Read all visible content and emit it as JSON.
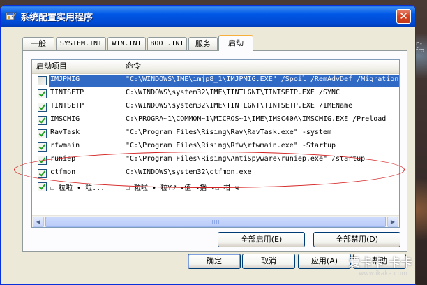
{
  "window": {
    "title": "系统配置实用程序",
    "close_glyph": "✕"
  },
  "tabs": [
    {
      "label": "一般"
    },
    {
      "label": "SYSTEM.INI"
    },
    {
      "label": "WIN.INI"
    },
    {
      "label": "BOOT.INI"
    },
    {
      "label": "服务"
    },
    {
      "label": "启动",
      "active": true
    }
  ],
  "listview": {
    "columns": [
      "启动项目",
      "命令"
    ],
    "rows": [
      {
        "name": "IMJPMIG",
        "command": "\"C:\\WINDOWS\\IME\\imjp8_1\\IMJPMIG.EXE\" /Spoil /RemAdvDef /Migration",
        "checked": false,
        "selected": true
      },
      {
        "name": "TINTSETP",
        "command": "C:\\WINDOWS\\system32\\IME\\TINTLGNT\\TINTSETP.EXE /SYNC",
        "checked": true
      },
      {
        "name": "TINTSETP",
        "command": "C:\\WINDOWS\\system32\\IME\\TINTLGNT\\TINTSETP.EXE /IMEName",
        "checked": true
      },
      {
        "name": "IMSCMIG",
        "command": "C:\\PROGRA~1\\COMMON~1\\MICROS~1\\IME\\IMSC40A\\IMSCMIG.EXE /Preload",
        "checked": true
      },
      {
        "name": "RavTask",
        "command": "\"C:\\Program Files\\Rising\\Rav\\RavTask.exe\" -system",
        "checked": true
      },
      {
        "name": "rfwmain",
        "command": "\"C:\\Program Files\\Rising\\Rfw\\rfwmain.exe\" -Startup",
        "checked": true
      },
      {
        "name": "runiep",
        "command": "\"C:\\Program Files\\Rising\\AntiSpyware\\runiep.exe\" /startup",
        "checked": true
      },
      {
        "name": "ctfmon",
        "command": "C:\\WINDOWS\\system32\\ctfmon.exe",
        "checked": true
      },
      {
        "name": "☐ 粒啦  •  粒...",
        "command": "☐ 粒啦  •  粒Ÿ♂  •值  •播  •☐ 柑 ч",
        "checked": true
      }
    ]
  },
  "buttons": {
    "enable_all": "全部启用(E)",
    "disable_all": "全部禁用(D)",
    "ok": "确定",
    "cancel": "取消",
    "apply": "应用(A)",
    "help": "帮助"
  },
  "watermark": {
    "brand": "爱卡卡 卡卡",
    "url": "www.ikaka.com"
  },
  "background": {
    "edge_text": "n-fro"
  },
  "colors": {
    "titlebar": "#0058e6",
    "selection": "#316ac5",
    "annotation": "#d42020",
    "tab_accent": "#f7b03b"
  }
}
